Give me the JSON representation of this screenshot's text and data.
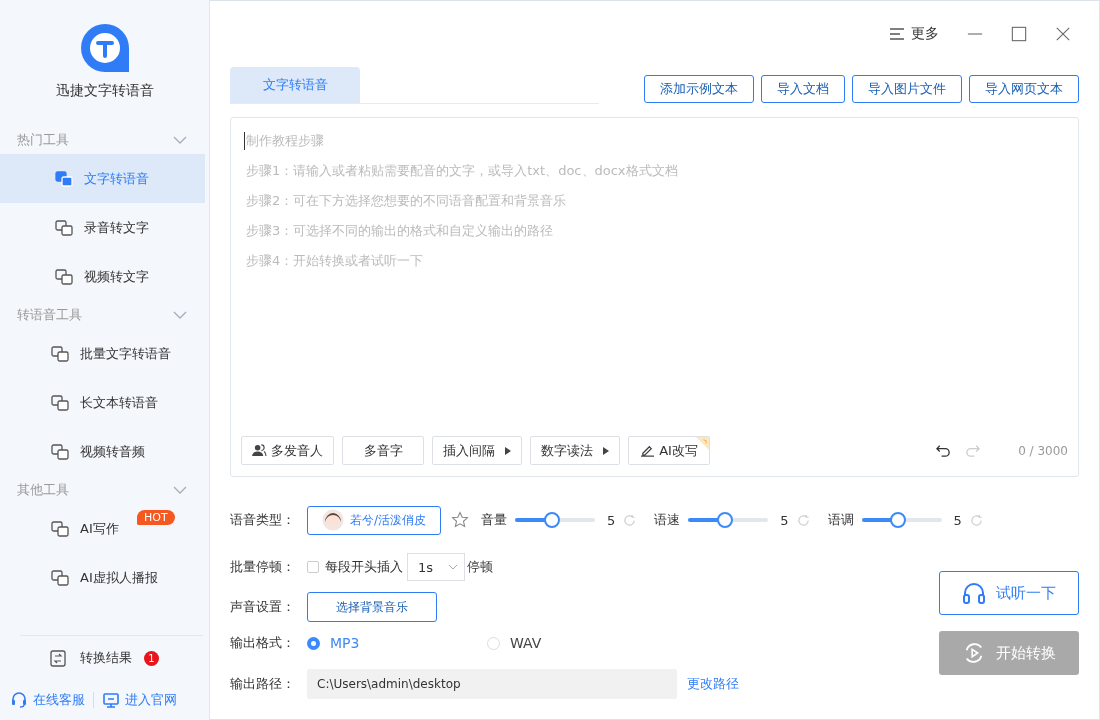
{
  "app": {
    "name": "迅捷文字转语音"
  },
  "window_controls": {
    "more_label": "更多"
  },
  "sidebar": {
    "groups": [
      {
        "title": "热门工具",
        "expanded": true,
        "items": [
          {
            "label": "文字转语音",
            "selected": true
          },
          {
            "label": "录音转文字",
            "selected": false
          },
          {
            "label": "视频转文字",
            "selected": false
          }
        ]
      },
      {
        "title": "转语音工具",
        "expanded": true,
        "items": [
          {
            "label": "批量文字转语音",
            "selected": false
          },
          {
            "label": "长文本转语音",
            "selected": false
          },
          {
            "label": "视频转音频",
            "selected": false
          }
        ]
      },
      {
        "title": "其他工具",
        "expanded": true,
        "items": [
          {
            "label": "AI写作",
            "selected": false,
            "badge": "HOT"
          },
          {
            "label": "AI虚拟人播报",
            "selected": false
          }
        ]
      }
    ],
    "results": {
      "label": "转换结果",
      "count": "1"
    },
    "footer": [
      {
        "label": "在线客服",
        "kind": "headset"
      },
      {
        "label": "进入官网",
        "kind": "monitor"
      }
    ]
  },
  "tabs": [
    {
      "label": "文字转语音",
      "selected": true
    }
  ],
  "import_buttons": [
    "添加示例文本",
    "导入文档",
    "导入图片文件",
    "导入网页文本"
  ],
  "editor": {
    "guide_lines": [
      "制作教程步骤",
      "步骤1：请输入或者粘贴需要配音的文字，或导入txt、doc、docx格式文档",
      "步骤2：可在下方选择您想要的不同语音配置和背景音乐",
      "步骤3：可选择不同的输出的格式和自定义输出的路径",
      "步骤4：开始转换或者试听一下"
    ],
    "tools": [
      {
        "label": "多发音人",
        "kind": "person"
      },
      {
        "label": "多音字",
        "kind": "plain"
      },
      {
        "label": "插入间隔",
        "kind": "menu"
      },
      {
        "label": "数字读法",
        "kind": "menu"
      },
      {
        "label": "AI改写",
        "kind": "pen"
      }
    ],
    "counter": "0 / 3000"
  },
  "voice": {
    "label": "语音类型：",
    "name": "若兮/活泼俏皮"
  },
  "sliders": [
    {
      "label": "音量",
      "level": 0.45,
      "reading": "5"
    },
    {
      "label": "语速",
      "level": 0.45,
      "reading": "5"
    },
    {
      "label": "语调",
      "level": 0.45,
      "reading": "5"
    }
  ],
  "pause": {
    "label": "批量停顿：",
    "checked": false,
    "option": "每段开头插入",
    "value": "1s",
    "suffix": "停顿"
  },
  "sound": {
    "label": "声音设置：",
    "button": "选择背景音乐"
  },
  "format": {
    "label": "输出格式：",
    "options": [
      {
        "label": "MP3",
        "selected": true
      },
      {
        "label": "WAV",
        "selected": false
      }
    ]
  },
  "path": {
    "label": "输出路径：",
    "value": "C:\\Users\\admin\\desktop",
    "link": "更改路径"
  },
  "listen_button": {
    "label": "试听一下"
  },
  "start_button": {
    "label": "开始转换",
    "disabled": true
  }
}
